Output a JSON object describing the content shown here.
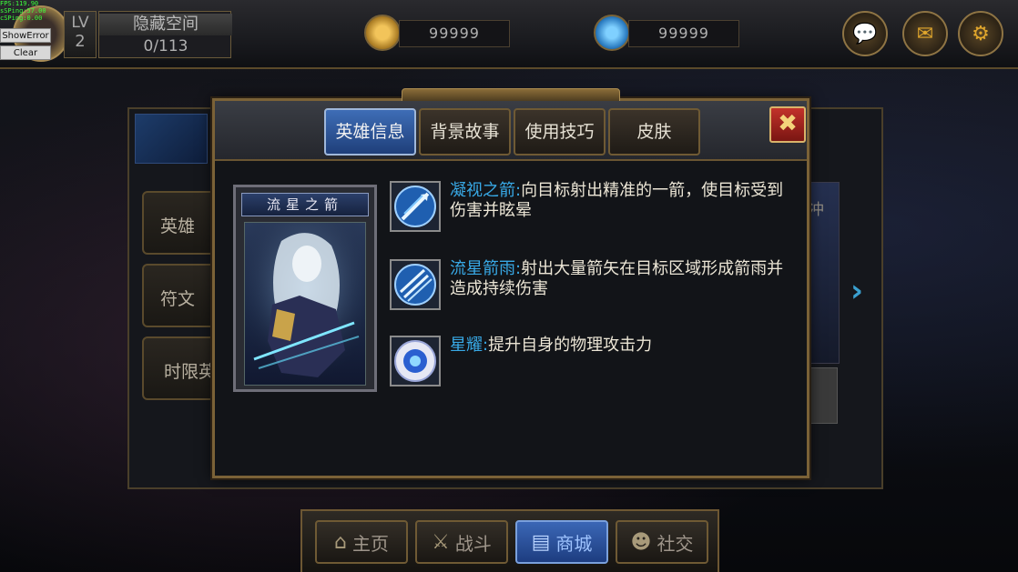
{
  "debug": {
    "lines": [
      "FPS:119.90",
      "sSPing:57.00",
      "cSPing:0.00"
    ],
    "show_error_label": "ShowError",
    "clear_label": "Clear"
  },
  "player": {
    "level_label": "LV",
    "level": "2",
    "room_title": "隐藏空间",
    "room_count": "0/113"
  },
  "resources": {
    "gold": "99999",
    "gem": "99999"
  },
  "background": {
    "side_buttons": [
      "英雄",
      "符文",
      "时限英"
    ],
    "right_label": "冲"
  },
  "modal": {
    "tabs": [
      {
        "label": "英雄信息",
        "active": true
      },
      {
        "label": "背景故事",
        "active": false
      },
      {
        "label": "使用技巧",
        "active": false
      },
      {
        "label": "皮肤",
        "active": false
      }
    ],
    "close_symbol": "✖",
    "hero_name": "流星之箭",
    "skills": [
      {
        "name": "凝视之箭",
        "sep": ":",
        "desc": "向目标射出精准的一箭，使目标受到伤害并眩晕",
        "icon": "arrow-skill-icon"
      },
      {
        "name": "流星箭雨",
        "sep": ":",
        "desc": "射出大量箭矢在目标区域形成箭雨并造成持续伤害",
        "icon": "arrow-rain-skill-icon"
      },
      {
        "name": "星耀",
        "sep": ":",
        "desc": "提升自身的物理攻击力",
        "icon": "star-orb-skill-icon"
      }
    ]
  },
  "bottom_nav": [
    {
      "label": "主页",
      "icon": "home-icon"
    },
    {
      "label": "战斗",
      "icon": "swords-icon"
    },
    {
      "label": "商城",
      "icon": "cart-icon"
    },
    {
      "label": "社交",
      "icon": "people-icon"
    }
  ],
  "colors": {
    "accent_gold": "#7b6237",
    "active_tab_blue": "#3e6db6",
    "skill_name_blue": "#38a9e6",
    "close_red": "#c2322a"
  }
}
